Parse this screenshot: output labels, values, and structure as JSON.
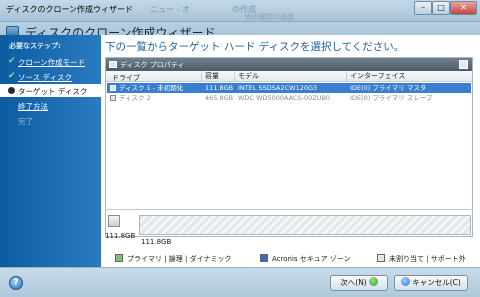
{
  "window": {
    "title": "ディスクのクローン作成ウィザード",
    "ghost_text_1": "ニュー - オ",
    "ghost_text_2": "の作成",
    "ghost_text_3": "他の種類の画面",
    "min_glyph": "–",
    "max_glyph": "□",
    "close_glyph": "✕"
  },
  "wizard": {
    "title": "ディスクのクローン作成ウィザード",
    "instruction": "下の一覧からターゲット ハード ディスクを選択してください。"
  },
  "sidebar": {
    "required_steps_label": "必要なステップ:",
    "steps": [
      {
        "label": "クローン作成モード",
        "status": "done"
      },
      {
        "label": "ソース ディスク",
        "status": "done"
      },
      {
        "label": "ターゲット ディスク",
        "status": "current"
      },
      {
        "label": "終了方法",
        "status": "link"
      },
      {
        "label": "完了",
        "status": "disabled"
      }
    ],
    "check_glyph": "✔"
  },
  "panel": {
    "toolbar_label": "ディスク プロパティ",
    "columns": [
      "ドライブ",
      "容量",
      "モデル",
      "インターフェイス"
    ],
    "rows": [
      {
        "drive": "ディスク 1 - 未初期化",
        "capacity": "111.8GB",
        "model": "INTEL SSDSA2CW120G3",
        "interface": "IDE(0) プライマリ マスタ",
        "selected": true
      },
      {
        "drive": "ディスク 2",
        "capacity": "465.8GB",
        "model": "WDC WD5000AACS-00ZUB0",
        "interface": "IDE(0) プライマリ スレーブ",
        "selected": false
      }
    ]
  },
  "disk_map": {
    "disk_size": "111.8GB",
    "partition_size": "111.8GB"
  },
  "legend": {
    "items": [
      {
        "label": "プライマリ | 論理 | ダイナミック",
        "color": "#7dc26a"
      },
      {
        "label": "Acronis セキュア ゾーン",
        "color": "#2e6fb5"
      },
      {
        "label": "未割り当て | サポート外",
        "color": "#e6e6e6"
      }
    ]
  },
  "footer": {
    "help_glyph": "?",
    "next_label": "次へ(N)",
    "cancel_label": "キャンセル(C)"
  },
  "colors": {
    "sidebar_bg": "#0d5ca1",
    "selection": "#3a7ed0",
    "instruction_text": "#1f5ea0"
  }
}
